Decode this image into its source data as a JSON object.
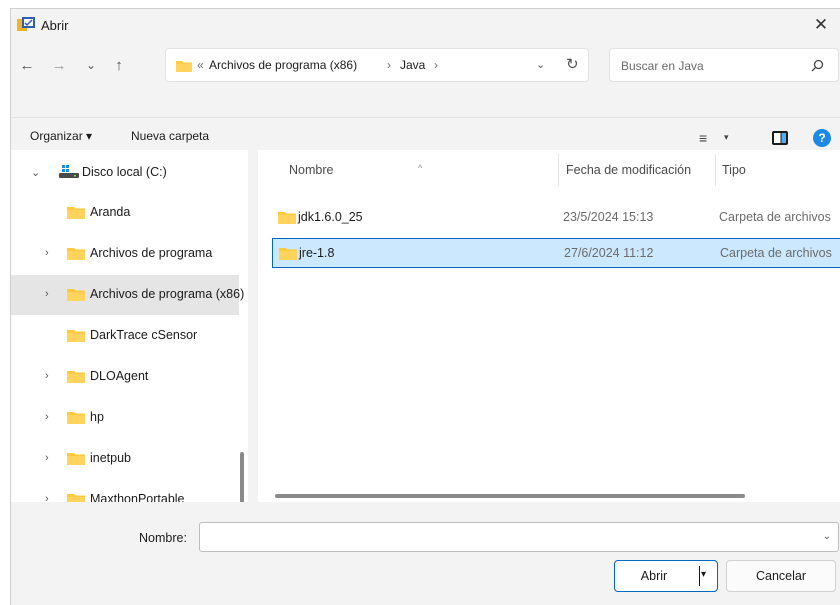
{
  "window": {
    "title": "Abrir",
    "close_glyph": "✕"
  },
  "nav": {
    "back_glyph": "←",
    "forward_glyph": "→",
    "recent_glyph": "⌄",
    "up_glyph": "↑",
    "breadcrumb_overflow": "«",
    "breadcrumbs": [
      "Archivos de programa (x86)",
      "Java"
    ],
    "separator": "›",
    "dropdown_glyph": "⌄",
    "refresh_glyph": "↻",
    "search_placeholder": "Buscar en Java"
  },
  "toolbar": {
    "organize_label": "Organizar ▾",
    "new_folder_label": "Nueva carpeta",
    "view_glyph": "≡",
    "view_drop_glyph": "▾",
    "help_glyph": "?"
  },
  "sidebar": {
    "drive_chevron": "⌄",
    "drive_label": "Disco local (C:)",
    "items": [
      {
        "label": "Aranda",
        "chevron": ""
      },
      {
        "label": "Archivos de programa",
        "chevron": "›"
      },
      {
        "label": "Archivos de programa (x86)",
        "chevron": "›",
        "selected": true
      },
      {
        "label": "DarkTrace cSensor",
        "chevron": ""
      },
      {
        "label": "DLOAgent",
        "chevron": "›"
      },
      {
        "label": "hp",
        "chevron": "›"
      },
      {
        "label": "inetpub",
        "chevron": "›"
      },
      {
        "label": "MaxthonPortable",
        "chevron": "›"
      }
    ]
  },
  "file_list": {
    "columns": [
      "Nombre",
      "Fecha de modificación",
      "Tipo"
    ],
    "sort_glyph": "^",
    "rows": [
      {
        "name": "jdk1.6.0_25",
        "modified": "23/5/2024 15:13",
        "type": "Carpeta de archivos",
        "selected": false
      },
      {
        "name": "jre-1.8",
        "modified": "27/6/2024 11:12",
        "type": "Carpeta de archivos",
        "selected": true
      }
    ]
  },
  "footer": {
    "name_label": "Nombre:",
    "name_value": "",
    "name_drop_glyph": "⌄",
    "open_label": "Abrir",
    "open_drop_glyph": "▾",
    "cancel_label": "Cancelar"
  },
  "colors": {
    "accent": "#0067c0",
    "selection": "#cce8ff",
    "folder": "#ffc83d",
    "help": "#1e88e5"
  }
}
